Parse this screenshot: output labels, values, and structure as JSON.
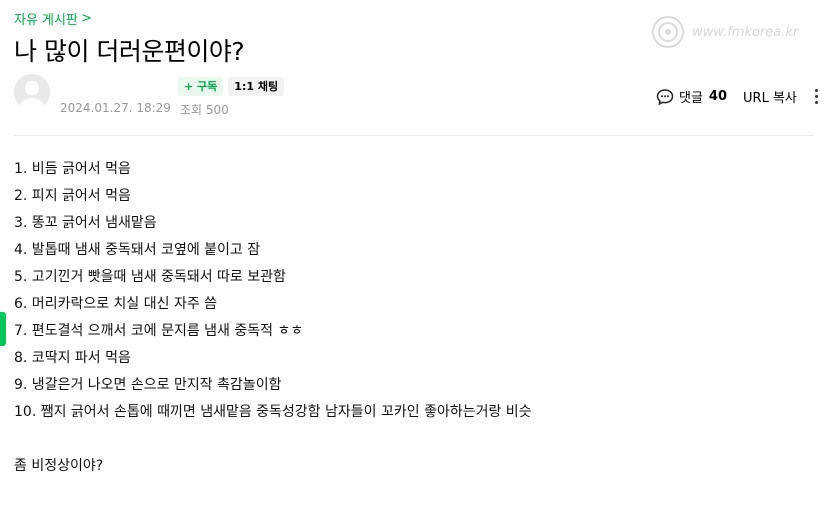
{
  "board": {
    "name": "자유 게시판"
  },
  "post": {
    "title": "나 많이 더러운편이야?",
    "date": "2024.01.27. 18:29",
    "views": "조회 500",
    "subscribe_label": "+ 구독",
    "chat_label": "1:1 채팅",
    "comment_label": "댓글",
    "comment_count": "40",
    "url_copy_label": "URL 복사",
    "lines": [
      "1. 비듬 긁어서 먹음",
      "2. 피지 긁어서 먹음",
      "3. 똥꼬 긁어서 냄새맡음",
      "4. 발톱때 냄새 중독돼서 코옆에 붙이고 잠",
      "5. 고기낀거 빳을때 냄새 중독돼서 따로 보관함",
      "6. 머리카락으로 치실 대신 자주 씀",
      "7. 편도결석 으깨서 코에 문지름 냄새 중독적 ㅎㅎ",
      "8. 코딱지 파서 먹음",
      "9. 냉갈은거 나오면 손으로 만지작 촉감놀이함",
      "10. 쨈지 긁어서 손톱에 때끼면 냄새맡음 중독성강함 남자들이 꼬카인 좋아하는거랑 비슷"
    ],
    "closing": "좀 비정상이야?"
  },
  "watermark": {
    "text": "www.fmkorea.kr"
  },
  "colors": {
    "accent": "#03a94d",
    "marker": "#03c75a"
  },
  "icons": {
    "board_chevron": "chevron-right-icon",
    "comments": "speech-bubble-icon",
    "more": "more-vertical-icon"
  }
}
